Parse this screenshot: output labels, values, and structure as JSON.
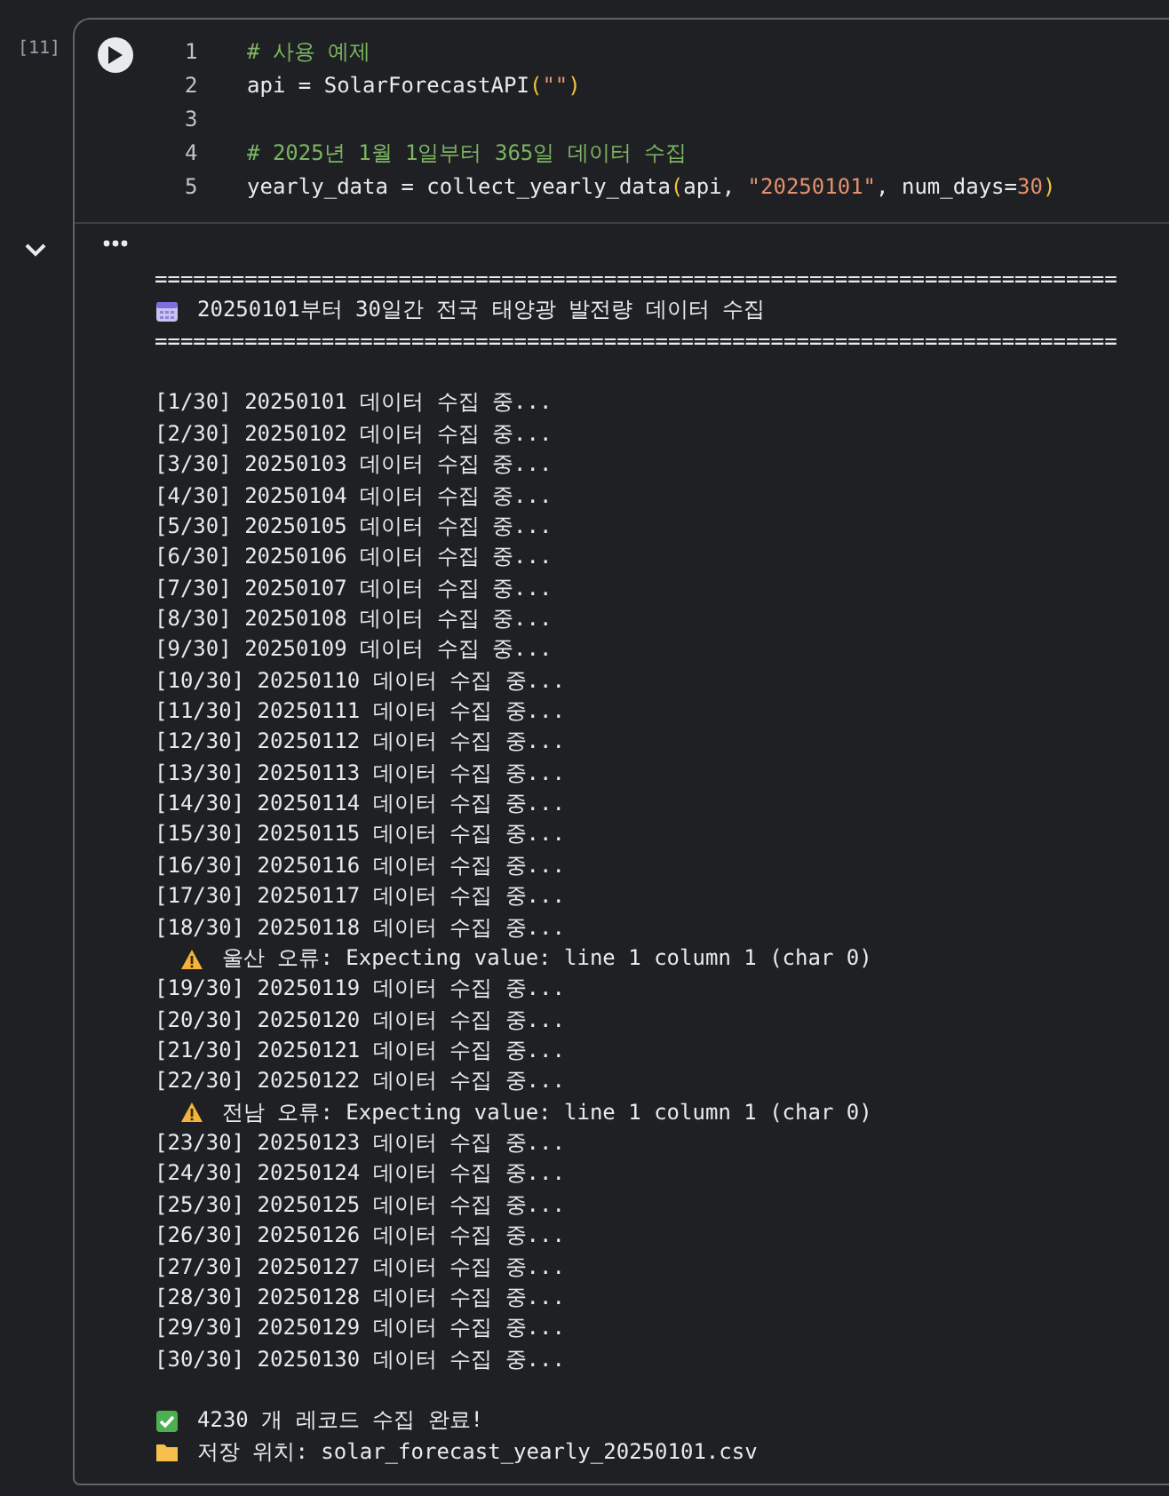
{
  "cell": {
    "execution_count": "[11]",
    "code_lines": [
      {
        "number": "1",
        "segments": [
          {
            "kind": "comment",
            "text": "# 사용 예제"
          }
        ]
      },
      {
        "number": "2",
        "segments": [
          {
            "kind": "plain",
            "text": "api = SolarForecastAPI"
          },
          {
            "kind": "paren",
            "text": "("
          },
          {
            "kind": "string",
            "text": "\"\""
          },
          {
            "kind": "paren",
            "text": ")"
          }
        ]
      },
      {
        "number": "3"
      },
      {
        "number": "4",
        "segments": [
          {
            "kind": "comment",
            "text": "# 2025년 1월 1일부터 365일 데이터 수집"
          }
        ]
      },
      {
        "number": "5",
        "segments": [
          {
            "kind": "plain",
            "text": "yearly_data = collect_yearly_data"
          },
          {
            "kind": "paren",
            "text": "("
          },
          {
            "kind": "plain",
            "text": "api, "
          },
          {
            "kind": "string",
            "text": "\"20250101\""
          },
          {
            "kind": "plain",
            "text": ", num_days="
          },
          {
            "kind": "number",
            "text": "30"
          },
          {
            "kind": "paren",
            "text": ")"
          }
        ]
      }
    ],
    "output_lines": [
      {
        "kind": "rule",
        "text": "==========================================================================="
      },
      {
        "kind": "calendar",
        "text": "20250101부터 30일간 전국 태양광 발전량 데이터 수집"
      },
      {
        "kind": "rule",
        "text": "==========================================================================="
      },
      {
        "kind": "blank"
      },
      {
        "kind": "text",
        "text": "[1/30] 20250101 데이터 수집 중..."
      },
      {
        "kind": "text",
        "text": "[2/30] 20250102 데이터 수집 중..."
      },
      {
        "kind": "text",
        "text": "[3/30] 20250103 데이터 수집 중..."
      },
      {
        "kind": "text",
        "text": "[4/30] 20250104 데이터 수집 중..."
      },
      {
        "kind": "text",
        "text": "[5/30] 20250105 데이터 수집 중..."
      },
      {
        "kind": "text",
        "text": "[6/30] 20250106 데이터 수집 중..."
      },
      {
        "kind": "text",
        "text": "[7/30] 20250107 데이터 수집 중..."
      },
      {
        "kind": "text",
        "text": "[8/30] 20250108 데이터 수집 중..."
      },
      {
        "kind": "text",
        "text": "[9/30] 20250109 데이터 수집 중..."
      },
      {
        "kind": "text",
        "text": "[10/30] 20250110 데이터 수집 중..."
      },
      {
        "kind": "text",
        "text": "[11/30] 20250111 데이터 수집 중..."
      },
      {
        "kind": "text",
        "text": "[12/30] 20250112 데이터 수집 중..."
      },
      {
        "kind": "text",
        "text": "[13/30] 20250113 데이터 수집 중..."
      },
      {
        "kind": "text",
        "text": "[14/30] 20250114 데이터 수집 중..."
      },
      {
        "kind": "text",
        "text": "[15/30] 20250115 데이터 수집 중..."
      },
      {
        "kind": "text",
        "text": "[16/30] 20250116 데이터 수집 중..."
      },
      {
        "kind": "text",
        "text": "[17/30] 20250117 데이터 수집 중..."
      },
      {
        "kind": "text",
        "text": "[18/30] 20250118 데이터 수집 중..."
      },
      {
        "kind": "warning",
        "text": "울산 오류: Expecting value: line 1 column 1 (char 0)"
      },
      {
        "kind": "text",
        "text": "[19/30] 20250119 데이터 수집 중..."
      },
      {
        "kind": "text",
        "text": "[20/30] 20250120 데이터 수집 중..."
      },
      {
        "kind": "text",
        "text": "[21/30] 20250121 데이터 수집 중..."
      },
      {
        "kind": "text",
        "text": "[22/30] 20250122 데이터 수집 중..."
      },
      {
        "kind": "warning",
        "text": "전남 오류: Expecting value: line 1 column 1 (char 0)"
      },
      {
        "kind": "text",
        "text": "[23/30] 20250123 데이터 수집 중..."
      },
      {
        "kind": "text",
        "text": "[24/30] 20250124 데이터 수집 중..."
      },
      {
        "kind": "text",
        "text": "[25/30] 20250125 데이터 수집 중..."
      },
      {
        "kind": "text",
        "text": "[26/30] 20250126 데이터 수집 중..."
      },
      {
        "kind": "text",
        "text": "[27/30] 20250127 데이터 수집 중..."
      },
      {
        "kind": "text",
        "text": "[28/30] 20250128 데이터 수집 중..."
      },
      {
        "kind": "text",
        "text": "[29/30] 20250129 데이터 수집 중..."
      },
      {
        "kind": "text",
        "text": "[30/30] 20250130 데이터 수집 중..."
      },
      {
        "kind": "blank"
      },
      {
        "kind": "success",
        "text": "4230 개 레코드 수집 완료!"
      },
      {
        "kind": "folder",
        "text": "저장 위치: solar_forecast_yearly_20250101.csv"
      }
    ]
  }
}
